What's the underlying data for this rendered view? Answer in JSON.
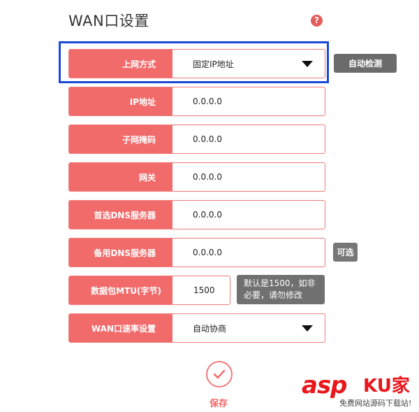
{
  "page": {
    "title": "WAN口设置",
    "help_icon": "?"
  },
  "form": {
    "connection_type": {
      "label": "上网方式",
      "value": "固定IP地址"
    },
    "ip_address": {
      "label": "IP地址",
      "value": "0.0.0.0"
    },
    "subnet_mask": {
      "label": "子网掩码",
      "value": "0.0.0.0"
    },
    "gateway": {
      "label": "网关",
      "value": "0.0.0.0"
    },
    "primary_dns": {
      "label": "首选DNS服务器",
      "value": "0.0.0.0"
    },
    "secondary_dns": {
      "label": "备用DNS服务器",
      "value": "0.0.0.0"
    },
    "mtu": {
      "label": "数据包MTU(字节)",
      "value": "1500"
    },
    "wan_speed": {
      "label": "WAN口速率设置",
      "value": "自动协商"
    }
  },
  "buttons": {
    "auto_detect": "自动检测",
    "optional": "可选",
    "save": "保存"
  },
  "tips": {
    "mtu_line1": "默认是1500，如非",
    "mtu_line2": "必要，请勿修改"
  },
  "watermark": {
    "asp": "asp",
    "ku": "KU",
    "jia": "家",
    "subtitle": "免费网站源码下载站!"
  },
  "colors": {
    "accent": "#f26b6b",
    "highlight_border": "#1a49d6",
    "grey_button": "#6b6b6b"
  }
}
